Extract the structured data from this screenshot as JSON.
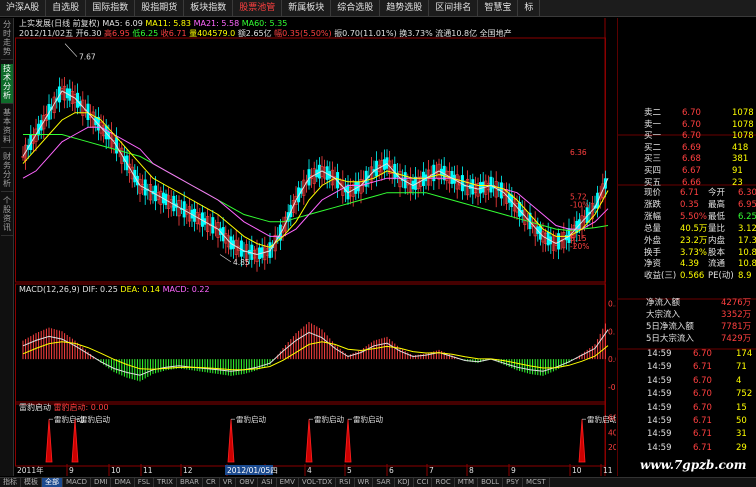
{
  "top_tabs": [
    "沪深A股",
    "自选股",
    "国际指数",
    "股指期货",
    "板块指数",
    "股票池管",
    "新属板块",
    "综合选股",
    "趋势选股",
    "区间排名",
    "智慧宝",
    "标"
  ],
  "active_top_tab": 5,
  "left_tabs": [
    "分时走势",
    "技术分析",
    "基本资料",
    "财务分析",
    "个股资讯"
  ],
  "active_left_tab": 1,
  "header": {
    "line1": {
      "title": "上实发展(日线 前复权)",
      "ma5": "MA5: 6.09",
      "ma11": "MA11: 5.83",
      "ma21": "MA21: 5.58",
      "ma60": "MA60: 5.35"
    },
    "line2": {
      "date": "2012/11/02五",
      "open": "开6.30",
      "high": "高6.95",
      "low": "低6.25",
      "close": "收6.71",
      "vol": "量404579.0",
      "amount": "额2.65亿",
      "change": "幅0.35(5.50%)",
      "amplitude": "振0.70(11.01%)",
      "turnover": "换3.73%",
      "float": "流通10.8亿",
      "sector": "全国地产"
    }
  },
  "price_labels": {
    "high_marker": "7.67",
    "low_marker": "4.85",
    "ask_marker": "6.36",
    "mid_price": "5.72",
    "mid_pct": "-10%",
    "low_price": "5.15",
    "low_pct": "-20%"
  },
  "macd": {
    "title": "MACD(12,26,9)",
    "dif": "DIF: 0.25",
    "dea": "DEA: 0.14",
    "macd": "MACD: 0.22",
    "ticks": [
      "0.30",
      "0.15",
      "0.00",
      "-0.15"
    ]
  },
  "signal": {
    "title": "雷豹启动",
    "value": "雷豹启动: 0.00",
    "label": "雷豹启动",
    "ticks": [
      "60.00",
      "40.00",
      "20.00"
    ]
  },
  "time_axis": {
    "year": "2011年",
    "months": [
      "9",
      "10",
      "11",
      "12",
      "2",
      "3",
      "4",
      "5",
      "6",
      "7",
      "8",
      "9",
      "10",
      "11"
    ],
    "cursor_date": "2012/01/05四"
  },
  "bottom_tabs": [
    "指标",
    "模板",
    "全部",
    "MACD",
    "DMI",
    "DMA",
    "FSL",
    "TRIX",
    "BRAR",
    "CR",
    "VR",
    "OBV",
    "ASI",
    "EMV",
    "VOL-TDX",
    "RSI",
    "WR",
    "SAR",
    "KDJ",
    "CCI",
    "ROC",
    "MTM",
    "BOLL",
    "PSY",
    "MCST"
  ],
  "active_bottom_tab": 2,
  "order_book": [
    {
      "label": "卖二",
      "price": "6.70",
      "vol": "1078"
    },
    {
      "label": "卖一",
      "price": "6.70",
      "vol": "1078"
    },
    {
      "label": "买一",
      "price": "6.70",
      "vol": "1078"
    },
    {
      "label": "买二",
      "price": "6.69",
      "vol": "418"
    },
    {
      "label": "买三",
      "price": "6.68",
      "vol": "381"
    },
    {
      "label": "买四",
      "price": "6.67",
      "vol": "91"
    },
    {
      "label": "买五",
      "price": "6.66",
      "vol": "23"
    }
  ],
  "quote": [
    {
      "l1": "现价",
      "v1": "6.71",
      "l2": "今开",
      "v2": "6.30"
    },
    {
      "l1": "涨跌",
      "v1": "0.35",
      "l2": "最高",
      "v2": "6.95"
    },
    {
      "l1": "涨幅",
      "v1": "5.50%",
      "l2": "最低",
      "v2": "6.25"
    },
    {
      "l1": "总量",
      "v1": "40.5万",
      "l2": "量比",
      "v2": "3.12"
    },
    {
      "l1": "外盘",
      "v1": "23.2万",
      "l2": "内盘",
      "v2": "17.37"
    },
    {
      "l1": "换手",
      "v1": "3.73%",
      "l2": "股本",
      "v2": "10.8亿"
    },
    {
      "l1": "净资",
      "v1": "4.39",
      "l2": "流通",
      "v2": "10.8亿"
    },
    {
      "l1": "收益(三)",
      "v1": "0.566",
      "l2": "PE(动)",
      "v2": "8.9"
    }
  ],
  "fund_flow": [
    {
      "label": "净流入额",
      "value": "4276万"
    },
    {
      "label": "大宗流入",
      "value": "3352万"
    },
    {
      "label": "5日净流入额",
      "value": "7781万"
    },
    {
      "label": "5日大宗流入",
      "value": "7429万"
    }
  ],
  "ticks": [
    {
      "time": "14:59",
      "price": "6.70",
      "vol": "174"
    },
    {
      "time": "14:59",
      "price": "6.71",
      "vol": "71"
    },
    {
      "time": "14:59",
      "price": "6.70",
      "vol": "4"
    },
    {
      "time": "14:59",
      "price": "6.70",
      "vol": "752"
    },
    {
      "time": "14:59",
      "price": "6.70",
      "vol": "15"
    },
    {
      "time": "14:59",
      "price": "6.71",
      "vol": "50"
    },
    {
      "time": "14:59",
      "price": "6.71",
      "vol": "31"
    },
    {
      "time": "14:59",
      "price": "6.71",
      "vol": "29"
    }
  ],
  "watermark": "www.7gpzb.com",
  "colors": {
    "up": "#ff4040",
    "down": "#33ff33",
    "ma5": "#e0e0e0",
    "ma11": "#ffff00",
    "ma21": "#ff66ff",
    "ma60": "#33ff33",
    "border": "#8b0000",
    "grid": "#6a0000"
  },
  "chart_data": {
    "type": "candlestick",
    "series": [
      {
        "name": "MA5",
        "values": [
          6.3,
          6.6,
          6.9,
          7.2,
          7.1,
          6.9,
          6.7,
          6.5,
          6.2,
          5.9,
          5.8,
          5.7,
          5.6,
          5.5,
          5.4,
          5.3,
          5.1,
          5.0,
          4.95,
          5.0,
          5.3,
          5.7,
          6.0,
          6.1,
          6.0,
          5.8,
          5.9,
          6.1,
          6.2,
          6.0,
          5.9,
          6.0,
          6.1,
          6.0,
          5.9,
          5.85,
          5.9,
          5.8,
          5.6,
          5.4,
          5.2,
          5.1,
          5.2,
          5.4,
          5.6,
          6.0
        ]
      },
      {
        "name": "MA11",
        "values": [
          6.2,
          6.4,
          6.6,
          6.8,
          6.9,
          6.9,
          6.8,
          6.6,
          6.4,
          6.2,
          6.0,
          5.9,
          5.8,
          5.7,
          5.6,
          5.5,
          5.35,
          5.2,
          5.1,
          5.05,
          5.2,
          5.4,
          5.7,
          5.9,
          6.0,
          5.95,
          5.95,
          6.0,
          6.1,
          6.05,
          6.0,
          6.0,
          6.05,
          6.0,
          5.95,
          5.9,
          5.9,
          5.85,
          5.7,
          5.5,
          5.3,
          5.2,
          5.2,
          5.3,
          5.5,
          5.83
        ]
      },
      {
        "name": "MA21",
        "values": [
          6.0,
          6.1,
          6.3,
          6.5,
          6.6,
          6.7,
          6.7,
          6.6,
          6.5,
          6.4,
          6.2,
          6.1,
          6.0,
          5.9,
          5.8,
          5.7,
          5.55,
          5.4,
          5.3,
          5.2,
          5.2,
          5.3,
          5.5,
          5.7,
          5.8,
          5.9,
          5.9,
          5.95,
          6.0,
          6.0,
          6.0,
          6.0,
          6.0,
          6.0,
          5.95,
          5.9,
          5.9,
          5.85,
          5.8,
          5.65,
          5.5,
          5.35,
          5.3,
          5.3,
          5.4,
          5.58
        ]
      },
      {
        "name": "MA60",
        "values": [
          6.6,
          6.6,
          6.6,
          6.6,
          6.55,
          6.5,
          6.45,
          6.4,
          6.35,
          6.3,
          6.2,
          6.1,
          6.0,
          5.9,
          5.8,
          5.7,
          5.6,
          5.5,
          5.45,
          5.4,
          5.4,
          5.45,
          5.5,
          5.55,
          5.6,
          5.65,
          5.7,
          5.75,
          5.8,
          5.8,
          5.8,
          5.8,
          5.75,
          5.7,
          5.65,
          5.6,
          5.55,
          5.5,
          5.45,
          5.4,
          5.35,
          5.3,
          5.28,
          5.3,
          5.32,
          5.35
        ]
      },
      {
        "name": "MACD",
        "values": [
          0.1,
          0.14,
          0.17,
          0.15,
          0.1,
          0.04,
          -0.02,
          -0.07,
          -0.1,
          -0.12,
          -0.08,
          -0.06,
          -0.05,
          -0.06,
          -0.07,
          -0.08,
          -0.09,
          -0.08,
          -0.06,
          -0.03,
          0.06,
          0.14,
          0.2,
          0.16,
          0.08,
          0.02,
          0.05,
          0.1,
          0.12,
          0.06,
          0.02,
          0.03,
          0.05,
          0.02,
          -0.01,
          -0.02,
          0.0,
          -0.03,
          -0.06,
          -0.08,
          -0.09,
          -0.06,
          -0.02,
          0.03,
          0.08,
          0.22
        ]
      },
      {
        "name": "雷豹启动",
        "values": [
          0,
          0,
          58,
          0,
          58,
          0,
          0,
          0,
          0,
          0,
          0,
          0,
          0,
          0,
          0,
          0,
          58,
          0,
          0,
          0,
          0,
          0,
          58,
          0,
          0,
          58,
          0,
          0,
          0,
          0,
          0,
          0,
          0,
          0,
          0,
          0,
          0,
          0,
          0,
          0,
          0,
          0,
          0,
          58,
          0,
          0
        ]
      }
    ]
  }
}
